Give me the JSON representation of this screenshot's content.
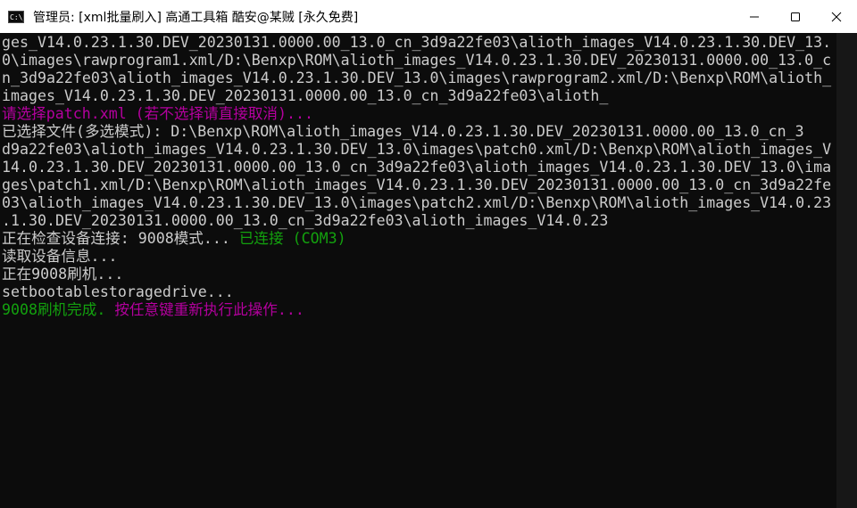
{
  "window": {
    "title": "管理员:  [xml批量刷入] 高通工具箱 酷安@某贼 [永久免费]",
    "icon_label": "C:\\_"
  },
  "colors": {
    "background": "#0c0c0c",
    "text": "#cccccc",
    "magenta": "#b4009e",
    "green": "#13a10e",
    "titlebar": "#ffffff"
  },
  "icons": {
    "app": "cmd-icon",
    "minimize": "minimize-icon",
    "maximize": "maximize-icon",
    "close": "close-icon"
  },
  "console": {
    "lines": [
      "ges_V14.0.23.1.30.DEV_20230131.0000.00_13.0_cn_3d9a22fe03\\alioth_images_V14.0.23.1.30.DEV_13.",
      "0\\images\\rawprogram1.xml/D:\\Benxp\\ROM\\alioth_images_V14.0.23.1.30.DEV_20230131.0000.00_13.0_c",
      "n_3d9a22fe03\\alioth_images_V14.0.23.1.30.DEV_13.0\\images\\rawprogram2.xml/D:\\Benxp\\ROM\\alioth_",
      "images_V14.0.23.1.30.DEV_20230131.0000.00_13.0_cn_3d9a22fe03\\alioth_",
      "请选择patch.xml (若不选择请直接取消)...",
      "已选择文件(多选模式): D:\\Benxp\\ROM\\alioth_images_V14.0.23.1.30.DEV_20230131.0000.00_13.0_cn_3",
      "d9a22fe03\\alioth_images_V14.0.23.1.30.DEV_13.0\\images\\patch0.xml/D:\\Benxp\\ROM\\alioth_images_V",
      "14.0.23.1.30.DEV_20230131.0000.00_13.0_cn_3d9a22fe03\\alioth_images_V14.0.23.1.30.DEV_13.0\\ima",
      "ges\\patch1.xml/D:\\Benxp\\ROM\\alioth_images_V14.0.23.1.30.DEV_20230131.0000.00_13.0_cn_3d9a22fe",
      "03\\alioth_images_V14.0.23.1.30.DEV_13.0\\images\\patch2.xml/D:\\Benxp\\ROM\\alioth_images_V14.0.23",
      ".1.30.DEV_20230131.0000.00_13.0_cn_3d9a22fe03\\alioth_images_V14.0.23"
    ],
    "check_prefix": "正在检查设备连接: 9008模式... ",
    "check_status": "已连接 (COM3)",
    "read_info": "读取设备信息...",
    "flashing": "正在9008刷机...",
    "setboot": "setbootablestoragedrive...",
    "done_text": "9008刷机完成. ",
    "done_prompt": "按任意键重新执行此操作..."
  }
}
